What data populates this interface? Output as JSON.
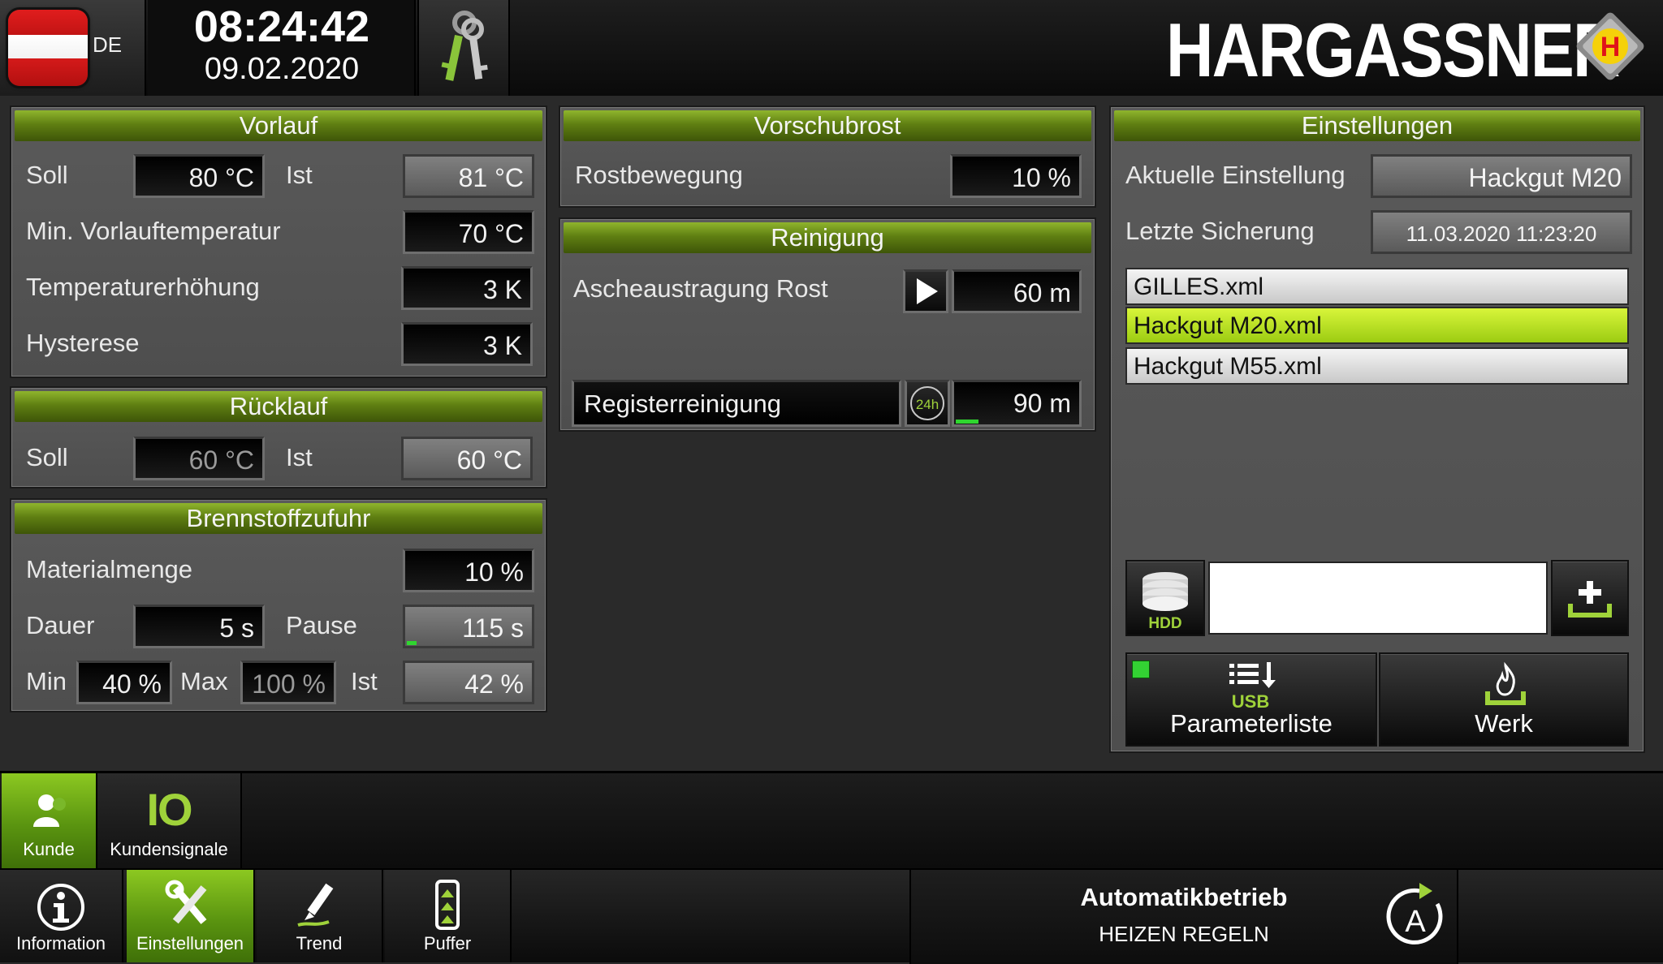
{
  "topbar": {
    "language": "DE",
    "time": "08:24:42",
    "date": "09.02.2020",
    "brand": "HARGASSNER",
    "brand_mark": "H",
    "colors": {
      "accent_green": "#8fb52d",
      "brand_yellow": "#f5d10a",
      "brand_red": "#e0131a"
    }
  },
  "vorlauf": {
    "title": "Vorlauf",
    "soll_label": "Soll",
    "soll_value": "80 °C",
    "ist_label": "Ist",
    "ist_value": "81 °C",
    "min_label": "Min. Vorlauftemperatur",
    "min_value": "70 °C",
    "erh_label": "Temperaturerhöhung",
    "erh_value": "3 K",
    "hys_label": "Hysterese",
    "hys_value": "3 K"
  },
  "ruecklauf": {
    "title": "Rücklauf",
    "soll_label": "Soll",
    "soll_value": "60 °C",
    "ist_label": "Ist",
    "ist_value": "60 °C"
  },
  "brennstoff": {
    "title": "Brennstoffzufuhr",
    "menge_label": "Materialmenge",
    "menge_value": "10 %",
    "dauer_label": "Dauer",
    "dauer_value": "5 s",
    "pause_label": "Pause",
    "pause_value": "115 s",
    "pause_progress": 0.08,
    "min_label": "Min",
    "min_value": "40 %",
    "max_label": "Max",
    "max_value": "100 %",
    "ist_label": "Ist",
    "ist_value": "42 %"
  },
  "vorschubrost": {
    "title": "Vorschubrost",
    "rost_label": "Rostbewegung",
    "rost_value": "10 %"
  },
  "reinigung": {
    "title": "Reinigung",
    "asche_label": "Ascheaustragung Rost",
    "asche_value": "60 m",
    "register_label": "Registerreinigung",
    "register_value": "90 m",
    "timer_badge": "24h",
    "register_progress": 0.18
  },
  "einstellungen": {
    "title": "Einstellungen",
    "aktuell_label": "Aktuelle Einstellung",
    "aktuell_value": "Hackgut M20",
    "sicherung_label": "Letzte Sicherung",
    "sicherung_value": "11.03.2020 11:23:20",
    "files": [
      "GILLES.xml",
      "Hackgut M20.xml",
      "Hackgut M55.xml"
    ],
    "selected_file": 1,
    "filename_input_value": "",
    "hdd_label": "HDD",
    "usb_label": "USB",
    "parameterliste_label": "Parameterliste",
    "werk_label": "Werk"
  },
  "subnav": {
    "kunde_label": "Kunde",
    "io_glyph": "IO",
    "kundensignale_label": "Kundensignale"
  },
  "mainnav": {
    "information_label": "Information",
    "einstellungen_label": "Einstellungen",
    "trend_label": "Trend",
    "puffer_label": "Puffer",
    "status_title": "Automatikbetrieb",
    "status_sub": "HEIZEN REGELN",
    "mode_letter": "A"
  }
}
